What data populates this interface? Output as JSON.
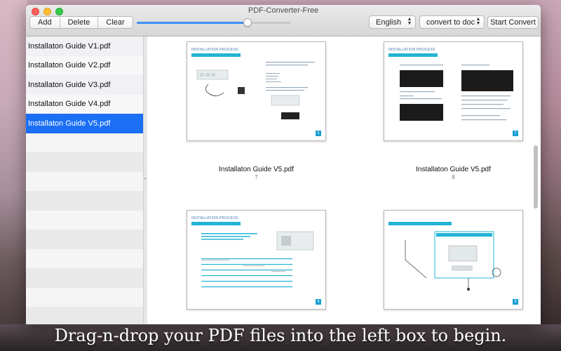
{
  "app": {
    "title": "PDF-Converter-Free"
  },
  "toolbar": {
    "add_label": "Add",
    "delete_label": "Delete",
    "clear_label": "Clear",
    "zoom_slider_value": 0.72,
    "language": "English",
    "mode": "convert to doc",
    "start_label": "Start Convert"
  },
  "sidebar": {
    "files": [
      {
        "name": "Installaton Guide V1.pdf"
      },
      {
        "name": "Installaton Guide V2.pdf"
      },
      {
        "name": "Installaton Guide V3.pdf"
      },
      {
        "name": "Installaton Guide V4.pdf"
      },
      {
        "name": "Installaton Guide V5.pdf"
      }
    ],
    "selected_index": 4
  },
  "preview": {
    "pages": [
      {
        "heading": "INSTALLATION PROCESS",
        "badge": "6",
        "file": "Installaton Guide V5.pdf",
        "page": "7"
      },
      {
        "heading": "INSTALLATION PROCESS",
        "badge": "7",
        "file": "Installaton Guide V5.pdf",
        "page": "8"
      },
      {
        "heading": "INSTALLATION PROCESS",
        "badge": "8"
      },
      {
        "heading": "",
        "badge": "9"
      }
    ]
  },
  "banner": {
    "text": "Drag-n-drop your PDF files into the left box to begin."
  },
  "colors": {
    "accent": "#1a6ff5",
    "thumb_accent": "#23b3d3"
  }
}
